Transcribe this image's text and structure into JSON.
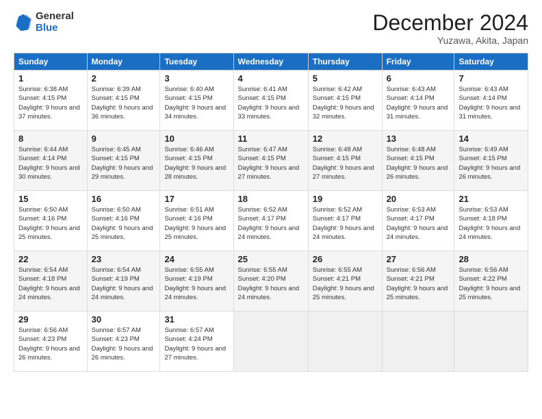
{
  "header": {
    "logo_general": "General",
    "logo_blue": "Blue",
    "month_title": "December 2024",
    "subtitle": "Yuzawa, Akita, Japan"
  },
  "calendar": {
    "headers": [
      "Sunday",
      "Monday",
      "Tuesday",
      "Wednesday",
      "Thursday",
      "Friday",
      "Saturday"
    ],
    "weeks": [
      [
        {
          "day": "1",
          "sunrise": "6:38 AM",
          "sunset": "4:15 PM",
          "daylight": "9 hours and 37 minutes."
        },
        {
          "day": "2",
          "sunrise": "6:39 AM",
          "sunset": "4:15 PM",
          "daylight": "9 hours and 36 minutes."
        },
        {
          "day": "3",
          "sunrise": "6:40 AM",
          "sunset": "4:15 PM",
          "daylight": "9 hours and 34 minutes."
        },
        {
          "day": "4",
          "sunrise": "6:41 AM",
          "sunset": "4:15 PM",
          "daylight": "9 hours and 33 minutes."
        },
        {
          "day": "5",
          "sunrise": "6:42 AM",
          "sunset": "4:15 PM",
          "daylight": "9 hours and 32 minutes."
        },
        {
          "day": "6",
          "sunrise": "6:43 AM",
          "sunset": "4:14 PM",
          "daylight": "9 hours and 31 minutes."
        },
        {
          "day": "7",
          "sunrise": "6:43 AM",
          "sunset": "4:14 PM",
          "daylight": "9 hours and 31 minutes."
        }
      ],
      [
        {
          "day": "8",
          "sunrise": "6:44 AM",
          "sunset": "4:14 PM",
          "daylight": "9 hours and 30 minutes."
        },
        {
          "day": "9",
          "sunrise": "6:45 AM",
          "sunset": "4:15 PM",
          "daylight": "9 hours and 29 minutes."
        },
        {
          "day": "10",
          "sunrise": "6:46 AM",
          "sunset": "4:15 PM",
          "daylight": "9 hours and 28 minutes."
        },
        {
          "day": "11",
          "sunrise": "6:47 AM",
          "sunset": "4:15 PM",
          "daylight": "9 hours and 27 minutes."
        },
        {
          "day": "12",
          "sunrise": "6:48 AM",
          "sunset": "4:15 PM",
          "daylight": "9 hours and 27 minutes."
        },
        {
          "day": "13",
          "sunrise": "6:48 AM",
          "sunset": "4:15 PM",
          "daylight": "9 hours and 26 minutes."
        },
        {
          "day": "14",
          "sunrise": "6:49 AM",
          "sunset": "4:15 PM",
          "daylight": "9 hours and 26 minutes."
        }
      ],
      [
        {
          "day": "15",
          "sunrise": "6:50 AM",
          "sunset": "4:16 PM",
          "daylight": "9 hours and 25 minutes."
        },
        {
          "day": "16",
          "sunrise": "6:50 AM",
          "sunset": "4:16 PM",
          "daylight": "9 hours and 25 minutes."
        },
        {
          "day": "17",
          "sunrise": "6:51 AM",
          "sunset": "4:16 PM",
          "daylight": "9 hours and 25 minutes."
        },
        {
          "day": "18",
          "sunrise": "6:52 AM",
          "sunset": "4:17 PM",
          "daylight": "9 hours and 24 minutes."
        },
        {
          "day": "19",
          "sunrise": "6:52 AM",
          "sunset": "4:17 PM",
          "daylight": "9 hours and 24 minutes."
        },
        {
          "day": "20",
          "sunrise": "6:53 AM",
          "sunset": "4:17 PM",
          "daylight": "9 hours and 24 minutes."
        },
        {
          "day": "21",
          "sunrise": "6:53 AM",
          "sunset": "4:18 PM",
          "daylight": "9 hours and 24 minutes."
        }
      ],
      [
        {
          "day": "22",
          "sunrise": "6:54 AM",
          "sunset": "4:18 PM",
          "daylight": "9 hours and 24 minutes."
        },
        {
          "day": "23",
          "sunrise": "6:54 AM",
          "sunset": "4:19 PM",
          "daylight": "9 hours and 24 minutes."
        },
        {
          "day": "24",
          "sunrise": "6:55 AM",
          "sunset": "4:19 PM",
          "daylight": "9 hours and 24 minutes."
        },
        {
          "day": "25",
          "sunrise": "6:55 AM",
          "sunset": "4:20 PM",
          "daylight": "9 hours and 24 minutes."
        },
        {
          "day": "26",
          "sunrise": "6:55 AM",
          "sunset": "4:21 PM",
          "daylight": "9 hours and 25 minutes."
        },
        {
          "day": "27",
          "sunrise": "6:56 AM",
          "sunset": "4:21 PM",
          "daylight": "9 hours and 25 minutes."
        },
        {
          "day": "28",
          "sunrise": "6:56 AM",
          "sunset": "4:22 PM",
          "daylight": "9 hours and 25 minutes."
        }
      ],
      [
        {
          "day": "29",
          "sunrise": "6:56 AM",
          "sunset": "4:23 PM",
          "daylight": "9 hours and 26 minutes."
        },
        {
          "day": "30",
          "sunrise": "6:57 AM",
          "sunset": "4:23 PM",
          "daylight": "9 hours and 26 minutes."
        },
        {
          "day": "31",
          "sunrise": "6:57 AM",
          "sunset": "4:24 PM",
          "daylight": "9 hours and 27 minutes."
        },
        null,
        null,
        null,
        null
      ]
    ]
  }
}
